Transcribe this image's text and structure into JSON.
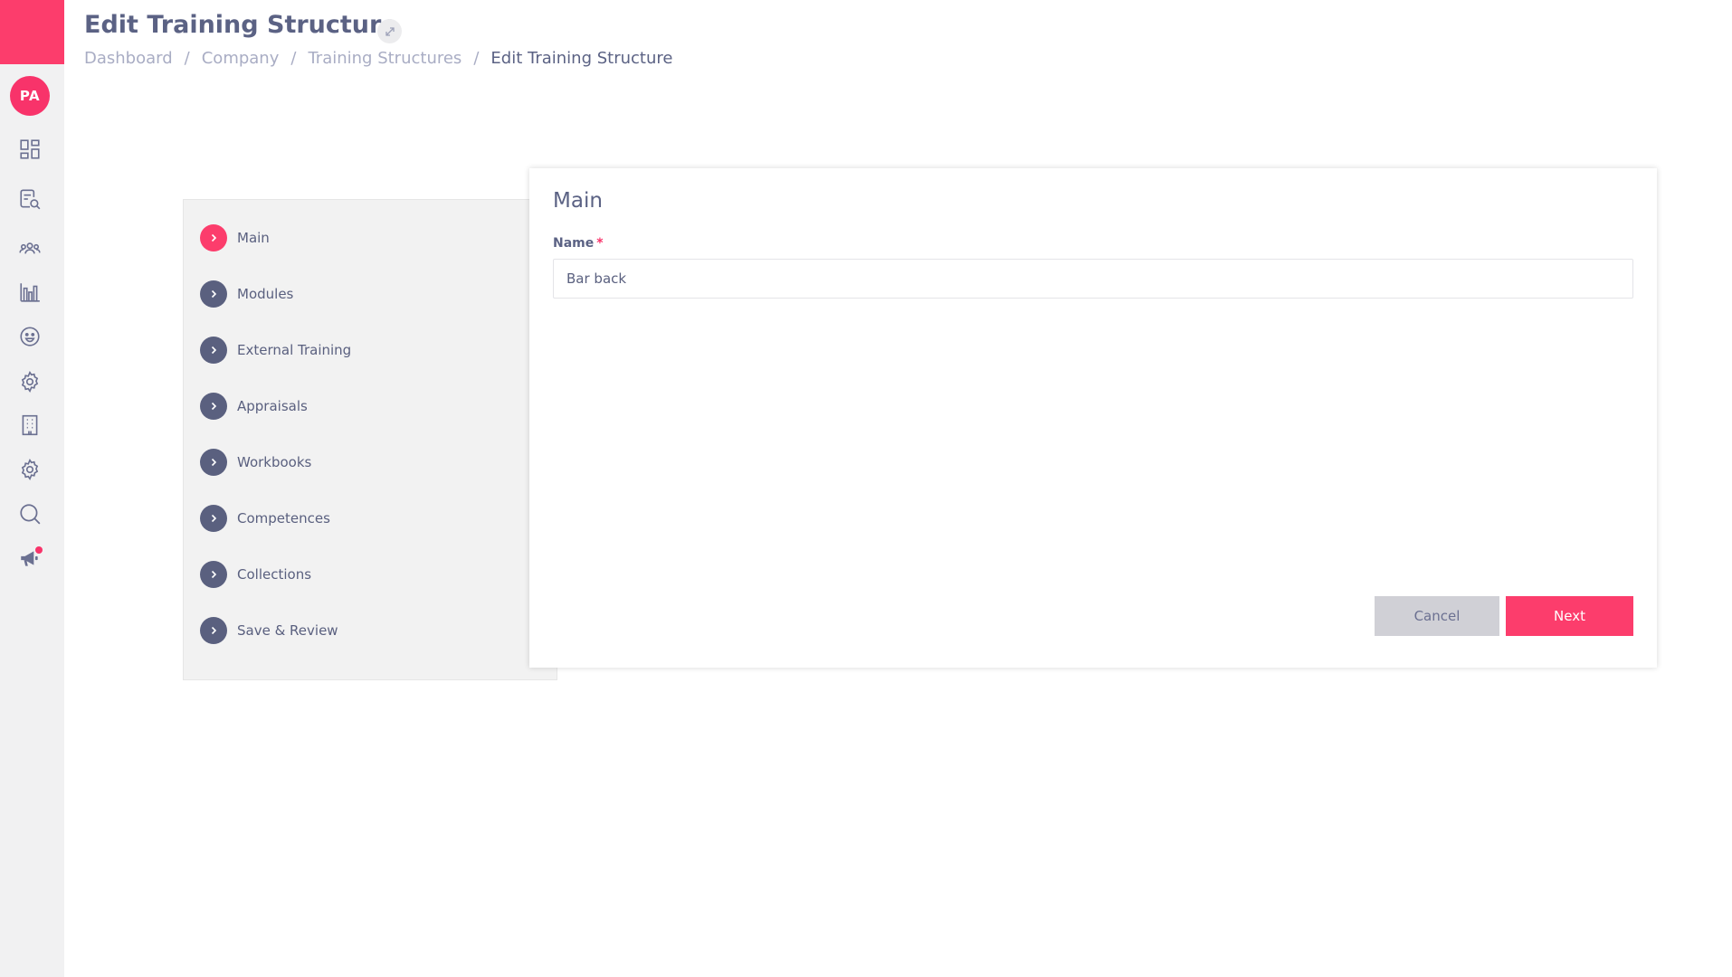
{
  "user": {
    "initials": "PA"
  },
  "header": {
    "title": "Edit Training Structure",
    "breadcrumb": [
      "Dashboard",
      "Company",
      "Training Structures",
      "Edit Training Structure"
    ],
    "separator": "/"
  },
  "nav_icons": [
    "dashboard-icon",
    "document-search-icon",
    "users-icon",
    "bar-chart-icon",
    "smiley-icon",
    "gear-icon",
    "building-icon",
    "gear-icon",
    "search-icon",
    "megaphone-icon"
  ],
  "steps": [
    {
      "label": "Main",
      "active": true
    },
    {
      "label": "Modules",
      "active": false
    },
    {
      "label": "External Training",
      "active": false
    },
    {
      "label": "Appraisals",
      "active": false
    },
    {
      "label": "Workbooks",
      "active": false
    },
    {
      "label": "Competences",
      "active": false
    },
    {
      "label": "Collections",
      "active": false
    },
    {
      "label": "Save & Review",
      "active": false
    }
  ],
  "form": {
    "section_title": "Main",
    "name_label": "Name",
    "required_mark": "*",
    "name_value": "Bar back",
    "cancel_label": "Cancel",
    "next_label": "Next"
  },
  "colors": {
    "accent": "#fc3d6c",
    "text": "#5a607f",
    "rail_bg": "#f1f1f2",
    "cancel_bg": "#d0d0d6"
  }
}
